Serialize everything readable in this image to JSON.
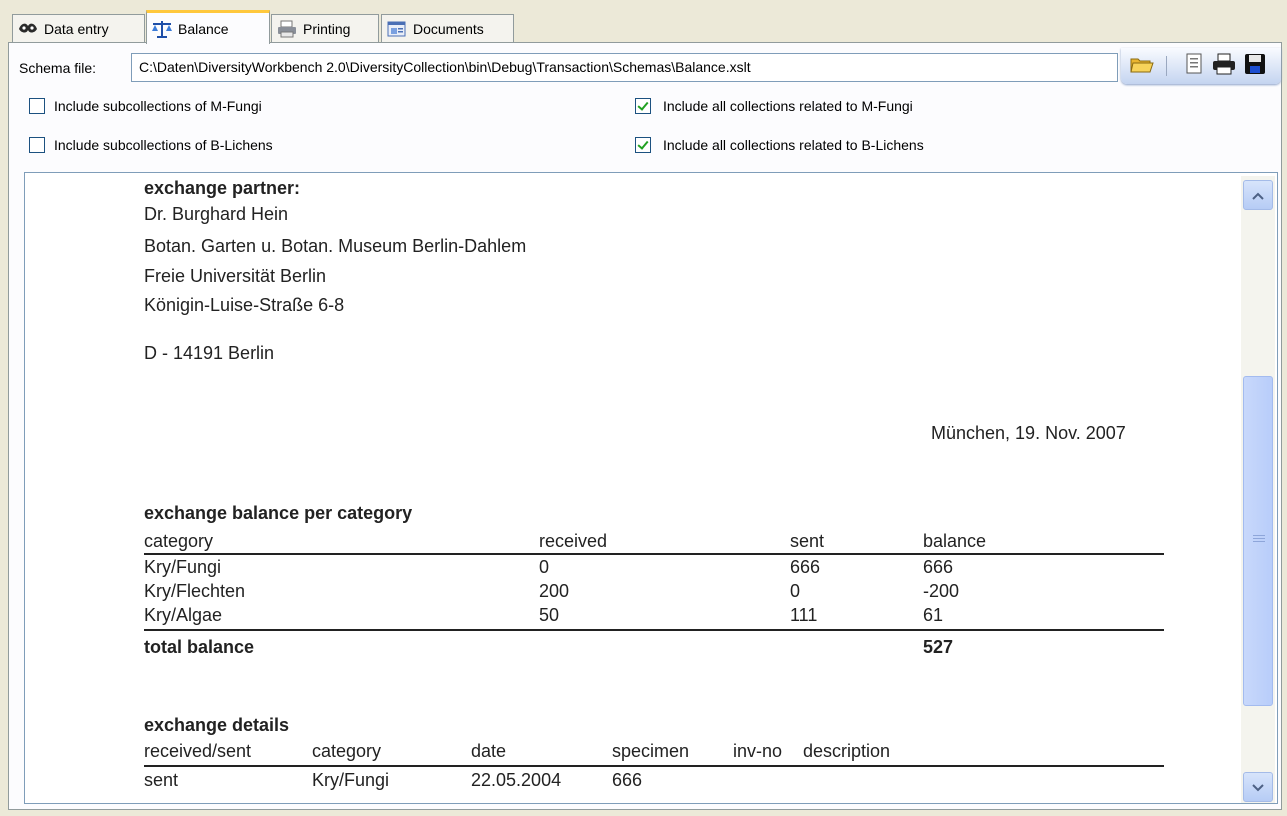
{
  "tabs": [
    {
      "label": "Data entry",
      "icon": "data-entry-icon"
    },
    {
      "label": "Balance",
      "icon": "balance-scale-icon"
    },
    {
      "label": "Printing",
      "icon": "printer-icon"
    },
    {
      "label": "Documents",
      "icon": "documents-icon"
    }
  ],
  "active_tab": "Balance",
  "schema": {
    "label": "Schema file:",
    "value": "C:\\Daten\\DiversityWorkbench 2.0\\DiversityCollection\\bin\\Debug\\Transaction\\Schemas\\Balance.xslt"
  },
  "toolbar": {
    "icons": [
      "open-folder-icon",
      "document-icon",
      "print-icon",
      "save-icon"
    ]
  },
  "options": [
    {
      "label": "Include subcollections of M-Fungi",
      "checked": false
    },
    {
      "label": "Include all collections related to M-Fungi",
      "checked": true
    },
    {
      "label": "Include subcollections of B-Lichens",
      "checked": false
    },
    {
      "label": "Include all collections related to B-Lichens",
      "checked": true
    }
  ],
  "document": {
    "partner_heading": "exchange partner:",
    "address": [
      "Dr. Burghard Hein",
      "Botan. Garten u. Botan. Museum Berlin-Dahlem",
      "Freie Universität Berlin",
      "Königin-Luise-Straße 6-8"
    ],
    "city": "D - 14191 Berlin",
    "place_date": "München, 19. Nov. 2007",
    "balance_heading": "exchange balance per category",
    "balance_columns": [
      "category",
      "received",
      "sent",
      "balance"
    ],
    "balance_rows": [
      [
        "Kry/Fungi",
        "0",
        "666",
        "666"
      ],
      [
        "Kry/Flechten",
        "200",
        "0",
        "-200"
      ],
      [
        "Kry/Algae",
        "50",
        "111",
        "61"
      ]
    ],
    "total_label": "total balance",
    "total_value": "527",
    "details_heading": "exchange details",
    "details_columns": [
      "received/sent",
      "category",
      "date",
      "specimen",
      "inv-no",
      "description"
    ],
    "details_rows": [
      [
        "sent",
        "Kry/Fungi",
        "22.05.2004",
        "666",
        "",
        ""
      ]
    ]
  }
}
